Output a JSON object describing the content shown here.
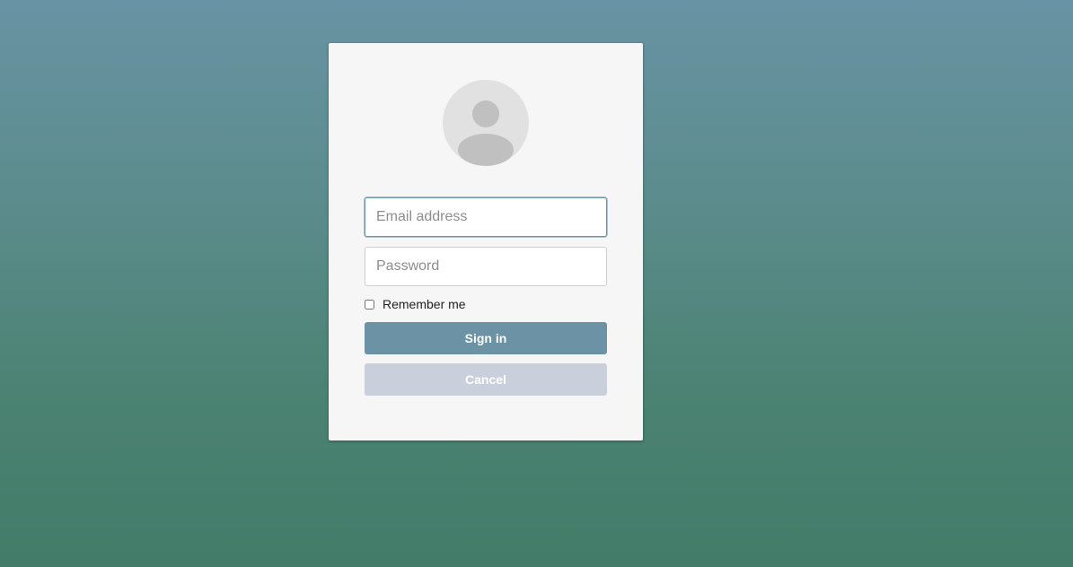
{
  "login": {
    "avatar_icon": "user-avatar-icon",
    "email_placeholder": "Email address",
    "email_value": "",
    "password_placeholder": "Password",
    "password_value": "",
    "remember_label": "Remember me",
    "remember_checked": false,
    "signin_label": "Sign in",
    "cancel_label": "Cancel"
  },
  "colors": {
    "background_top": "#6893a4",
    "background_bottom": "#437c69",
    "card": "#f6f6f7",
    "primary_button": "#6b93a5",
    "secondary_button": "#cacfdc",
    "focus_border": "#6b96a6"
  }
}
